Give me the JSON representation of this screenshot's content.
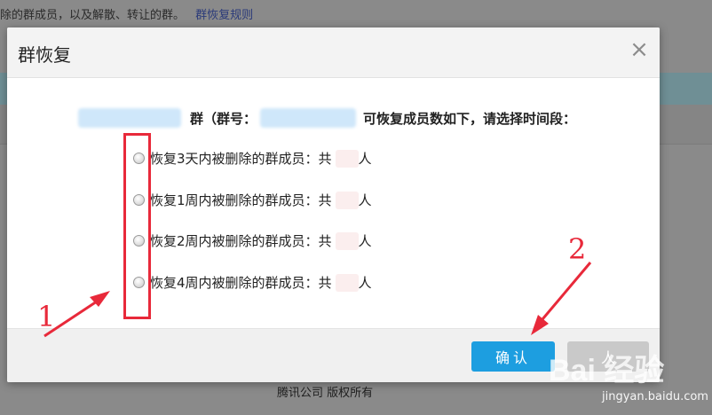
{
  "background": {
    "top_text": "除的群成员，以及解散、转让的群。",
    "rules_link": "群恢复规则",
    "footer": "腾讯公司 版权所有"
  },
  "dialog": {
    "title": "群恢复",
    "close_label": "×",
    "prompt": {
      "part1": "群（群号：",
      "part2": "可恢复成员数如下，请选择时间段："
    },
    "options": [
      {
        "label": "恢复3天内被删除的群成员：共",
        "unit": "人"
      },
      {
        "label": "恢复1周内被删除的群成员：共",
        "unit": "人"
      },
      {
        "label": "恢复2周内被删除的群成员：共",
        "unit": "人"
      },
      {
        "label": "恢复4周内被删除的群成员：共",
        "unit": "人"
      }
    ],
    "confirm_label": "确认",
    "cancel_label": "人"
  },
  "annotations": {
    "label_1": "1",
    "label_2": "2",
    "color": "#e8293a"
  },
  "watermark": {
    "logo": "Bai 经验",
    "url": "jingyan.baidu.com"
  }
}
